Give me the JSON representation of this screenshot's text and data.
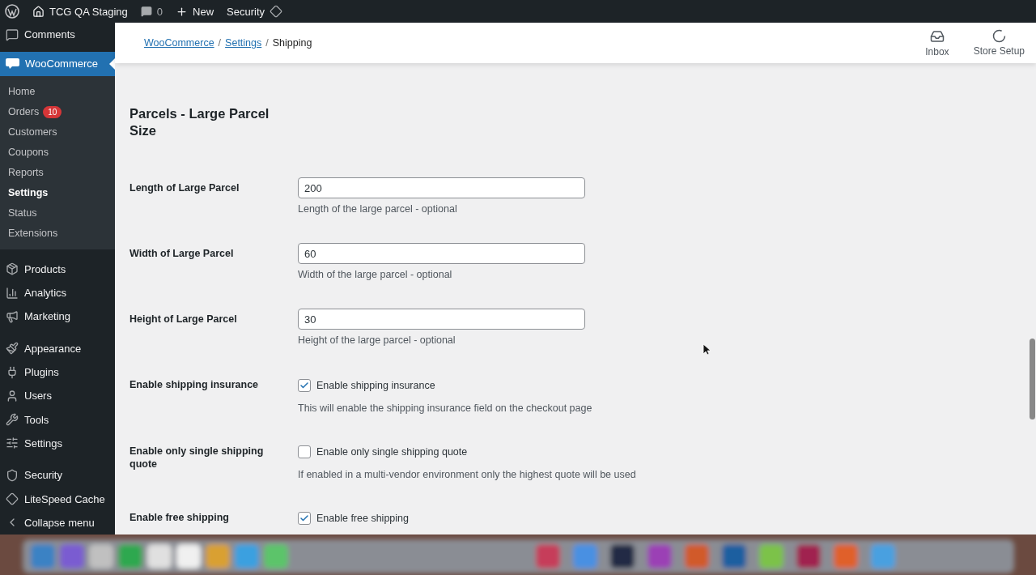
{
  "admin_bar": {
    "site": "TCG QA Staging",
    "comments": "0",
    "new": "New",
    "security": "Security"
  },
  "sidebar": {
    "items": [
      {
        "label": "Comments",
        "selected": false
      },
      {
        "label": "WooCommerce",
        "selected": true,
        "expanded": true,
        "children": [
          {
            "label": "Home",
            "selected": false
          },
          {
            "label": "Orders",
            "selected": false,
            "badge": "10"
          },
          {
            "label": "Customers",
            "selected": false
          },
          {
            "label": "Coupons",
            "selected": false
          },
          {
            "label": "Reports",
            "selected": false
          },
          {
            "label": "Settings",
            "selected": true
          },
          {
            "label": "Status",
            "selected": false
          },
          {
            "label": "Extensions",
            "selected": false
          }
        ]
      },
      {
        "label": "Products",
        "selected": false
      },
      {
        "label": "Analytics",
        "selected": false
      },
      {
        "label": "Marketing",
        "selected": false
      },
      {
        "label": "Appearance",
        "selected": false
      },
      {
        "label": "Plugins",
        "selected": false
      },
      {
        "label": "Users",
        "selected": false
      },
      {
        "label": "Tools",
        "selected": false
      },
      {
        "label": "Settings",
        "selected": false
      },
      {
        "label": "Security",
        "selected": false
      },
      {
        "label": "LiteSpeed Cache",
        "selected": false
      },
      {
        "label": "Collapse menu",
        "selected": false
      }
    ]
  },
  "header": {
    "breadcrumbs": [
      "WooCommerce",
      "Settings",
      "Shipping"
    ],
    "separator": "/",
    "actions": [
      "Inbox",
      "Store Setup"
    ]
  },
  "section_title": "Parcels - Large Parcel Size",
  "settings": [
    {
      "kind": "text",
      "label": "Length of Large Parcel",
      "value": "200",
      "description": "Length of the large parcel - optional"
    },
    {
      "kind": "text",
      "label": "Width of Large Parcel",
      "value": "60",
      "description": "Width of the large parcel - optional"
    },
    {
      "kind": "text",
      "label": "Height of Large Parcel",
      "value": "30",
      "description": "Height of the large parcel - optional"
    },
    {
      "kind": "checkbox",
      "label": "Enable shipping insurance",
      "option": "Enable shipping insurance",
      "checked": true,
      "description": "This will enable the shipping insurance field on the checkout page"
    },
    {
      "kind": "checkbox",
      "label": "Enable only single shipping quote",
      "option": "Enable only single shipping quote",
      "checked": false,
      "description": "If enabled in a multi-vendor environment only the highest quote will be used"
    },
    {
      "kind": "checkbox",
      "label": "Enable free shipping",
      "option": "Enable free shipping",
      "checked": true
    }
  ]
}
